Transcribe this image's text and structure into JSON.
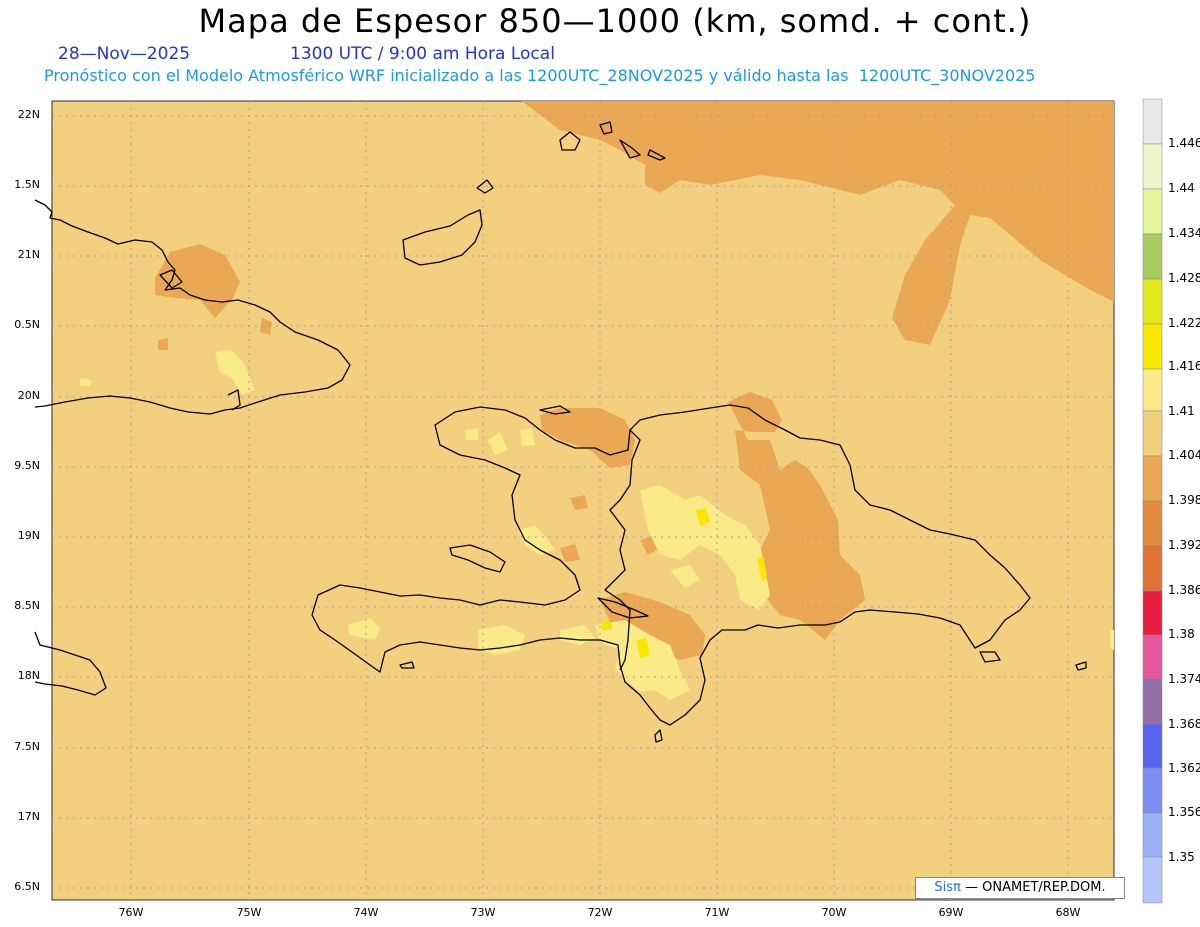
{
  "header": {
    "title": "Mapa de Espesor 850—1000 (km, somd. + cont.)",
    "date": "28—Nov—2025",
    "time": "1300 UTC / 9:00 am Hora Local",
    "subtitle": "Pronóstico con el Modelo Atmosférico WRF inicializado a las 1200UTC_28NOV2025 y válido hasta las  1200UTC_30NOV2025"
  },
  "axes": {
    "lat_labels": [
      "22N",
      "1.5N",
      "21N",
      "0.5N",
      "20N",
      "9.5N",
      "19N",
      "8.5N",
      "18N",
      "7.5N",
      "17N",
      "6.5N"
    ],
    "lon_labels": [
      "76W",
      "75W",
      "74W",
      "73W",
      "72W",
      "71W",
      "70W",
      "69W",
      "68W"
    ]
  },
  "colorbar": {
    "labels": [
      "1.446",
      "1.44",
      "1.434",
      "1.428",
      "1.422",
      "1.416",
      "1.41",
      "1.404",
      "1.398",
      "1.392",
      "1.386",
      "1.38",
      "1.374",
      "1.368",
      "1.362",
      "1.356",
      "1.35"
    ],
    "colors_top_to_bottom": [
      "#e8e8e8",
      "#f2f5cc",
      "#e6f59a",
      "#a8cc60",
      "#e2e81c",
      "#f8e800",
      "#fbea88",
      "#f3cf80",
      "#eba854",
      "#e48a3c",
      "#df7434",
      "#ea1d42",
      "#ea55a0",
      "#9370a8",
      "#5a65ee",
      "#7e8ef4",
      "#9eb2fa",
      "#b6c6fb"
    ]
  },
  "colors": {
    "background_field": "#f3cf80",
    "field_1398": "#eba854",
    "field_141": "#fbea88",
    "field_1416": "#f8e800",
    "coastline": "#000000",
    "grid": "#a0a0a0"
  },
  "credit": {
    "sis": "Sisπ",
    "org": "— ONAMET/REP.DOM."
  }
}
